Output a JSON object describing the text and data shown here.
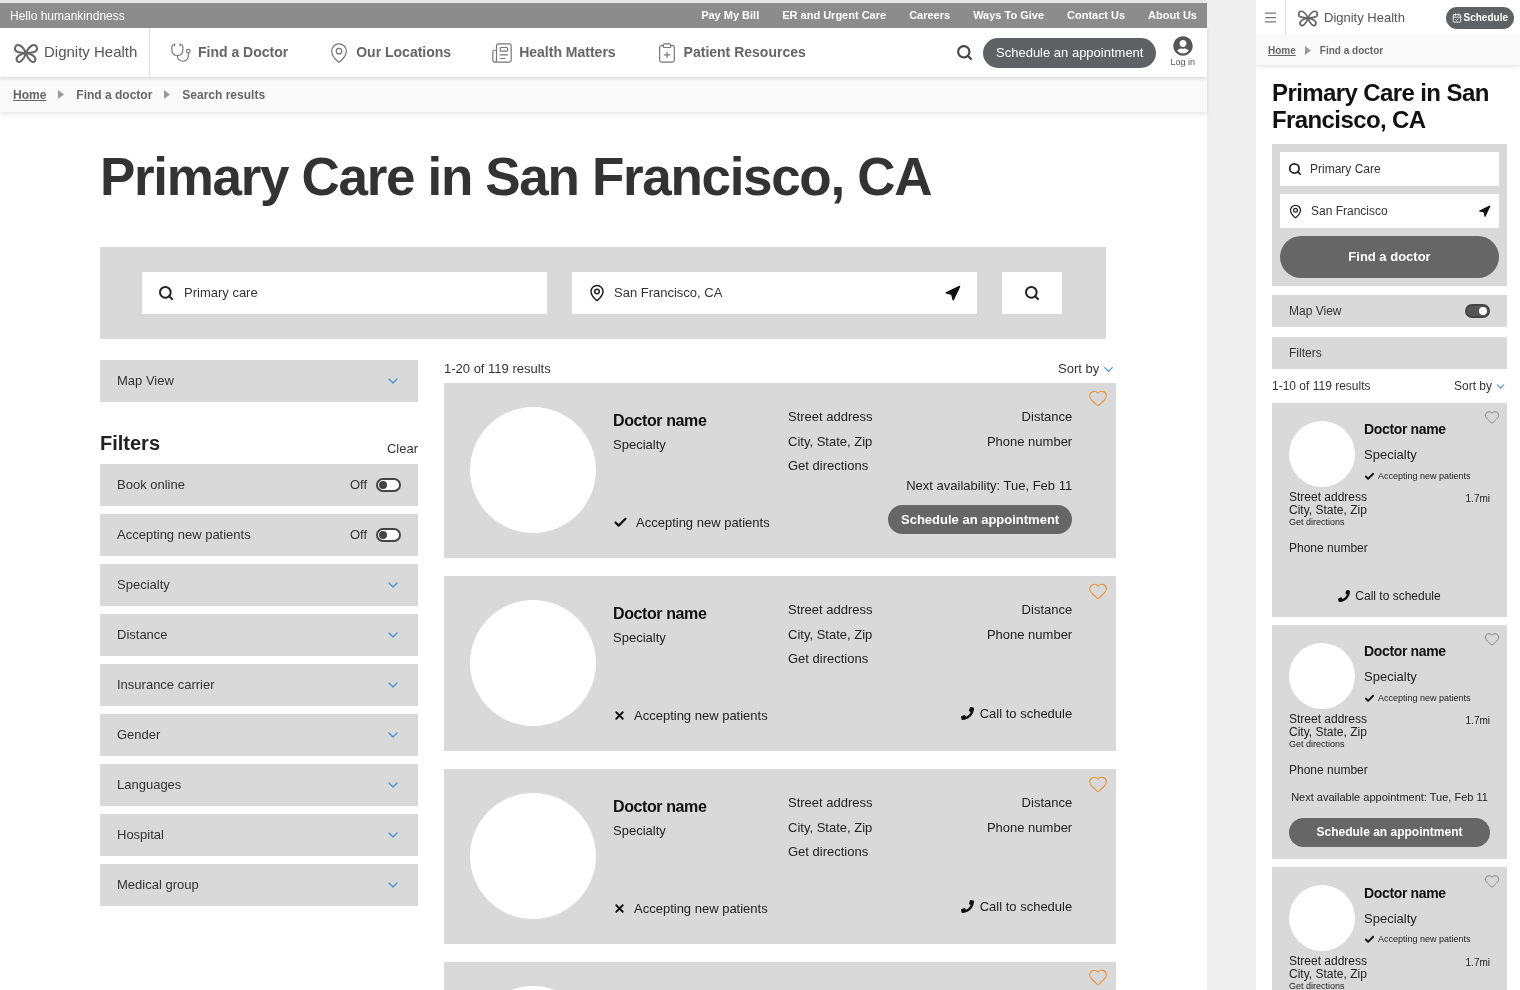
{
  "desktop": {
    "utility_bar": {
      "greeting": "Hello humankindness",
      "links": [
        "Pay My Bill",
        "ER and Urgent Care",
        "Careers",
        "Ways To Give",
        "Contact Us",
        "About Us"
      ]
    },
    "header": {
      "logo": "Dignity Health",
      "nav": [
        {
          "kind": "doctor",
          "label": "Find a Doctor"
        },
        {
          "kind": "locations",
          "label": "Our Locations"
        },
        {
          "kind": "articles",
          "label": "Health Matters"
        },
        {
          "kind": "resources",
          "label": "Patient Resources"
        }
      ],
      "schedule_button": "Schedule an appointment",
      "login": "Log in"
    },
    "breadcrumb": [
      {
        "kind": "link",
        "label": "Home"
      },
      {
        "kind": "text",
        "label": "Find a doctor"
      },
      {
        "kind": "text",
        "label": "Search results"
      }
    ],
    "title": "Primary Care in San Francisco, CA",
    "search": {
      "query": "Primary care",
      "location": "San Francisco, CA"
    },
    "map_view": {
      "label": "Map View",
      "expanded": false
    },
    "filters": {
      "title": "Filters",
      "clear": "Clear",
      "items": [
        {
          "kind": "toggle",
          "label": "Book online",
          "value": "Off",
          "on": false
        },
        {
          "kind": "toggle",
          "label": "Accepting new patients",
          "value": "Off",
          "on": false
        },
        {
          "kind": "dropdown",
          "label": "Specialty",
          "expanded": false
        },
        {
          "kind": "dropdown",
          "label": "Distance",
          "expanded": false
        },
        {
          "kind": "dropdown",
          "label": "Insurance carrier",
          "expanded": false
        },
        {
          "kind": "dropdown",
          "label": "Gender",
          "expanded": false
        },
        {
          "kind": "dropdown",
          "label": "Languages",
          "expanded": false
        },
        {
          "kind": "dropdown",
          "label": "Hospital",
          "expanded": false
        },
        {
          "kind": "dropdown",
          "label": "Medical group",
          "expanded": false
        }
      ]
    },
    "results_count": "1-20 of 119 results",
    "sort_label": "Sort by",
    "results": [
      {
        "kind": "full",
        "name": "Doctor name",
        "specialty": "Specialty",
        "address": [
          "Street address",
          "City, State, Zip"
        ],
        "directions": "Get directions",
        "distance": "Distance",
        "phone": "Phone number",
        "accepting": true,
        "accepting_label": "Accepting new patients",
        "availability": "Next availability: Tue, Feb 11",
        "action": {
          "kind": "schedule",
          "label": "Schedule an appointment"
        }
      },
      {
        "kind": "full",
        "name": "Doctor name",
        "specialty": "Specialty",
        "address": [
          "Street address",
          "City, State, Zip"
        ],
        "directions": "Get directions",
        "distance": "Distance",
        "phone": "Phone number",
        "accepting": false,
        "accepting_label": "Accepting new patients",
        "action": {
          "kind": "call",
          "label": "Call to schedule"
        }
      },
      {
        "kind": "full",
        "name": "Doctor name",
        "specialty": "Specialty",
        "address": [
          "Street address",
          "City, State, Zip"
        ],
        "directions": "Get directions",
        "distance": "Distance",
        "phone": "Phone number",
        "accepting": false,
        "accepting_label": "Accepting new patients",
        "action": {
          "kind": "call",
          "label": "Call to schedule"
        }
      },
      {
        "kind": "cut"
      }
    ]
  },
  "mobile": {
    "header": {
      "logo": "Dignity Health",
      "schedule_button": "Schedule"
    },
    "breadcrumb": [
      {
        "kind": "link",
        "label": "Home"
      },
      {
        "kind": "text",
        "label": "Find a doctor"
      }
    ],
    "title": "Primary Care in San Francisco, CA",
    "search": {
      "query": "Primary Care",
      "location": "San Francisco",
      "button": "Find a doctor"
    },
    "map_view": {
      "label": "Map View",
      "on": true
    },
    "filters_label": "Filters",
    "results_count": "1-10 of 119 results",
    "sort_label": "Sort by",
    "results": [
      {
        "name": "Doctor name",
        "specialty": "Specialty",
        "accepting": true,
        "accepting_label": "Accepting new patients",
        "address": [
          "Street address",
          "City, State, Zip"
        ],
        "directions": "Get directions",
        "distance": "1.7mi",
        "phone": "Phone number",
        "action": {
          "kind": "call",
          "label": "Call to schedule"
        }
      },
      {
        "name": "Doctor name",
        "specialty": "Specialty",
        "accepting": true,
        "accepting_label": "Accepting new patients",
        "address": [
          "Street address",
          "City, State, Zip"
        ],
        "directions": "Get directions",
        "distance": "1.7mi",
        "phone": "Phone number",
        "availability": "Next available appointment: Tue, Feb 11",
        "action": {
          "kind": "schedule",
          "label": "Schedule an appointment"
        }
      },
      {
        "name": "Doctor name",
        "specialty": "Specialty",
        "accepting": true,
        "accepting_label": "Accepting new patients",
        "address": [
          "Street address",
          "City, State, Zip"
        ],
        "directions": "Get directions",
        "distance": "1.7mi"
      }
    ]
  }
}
